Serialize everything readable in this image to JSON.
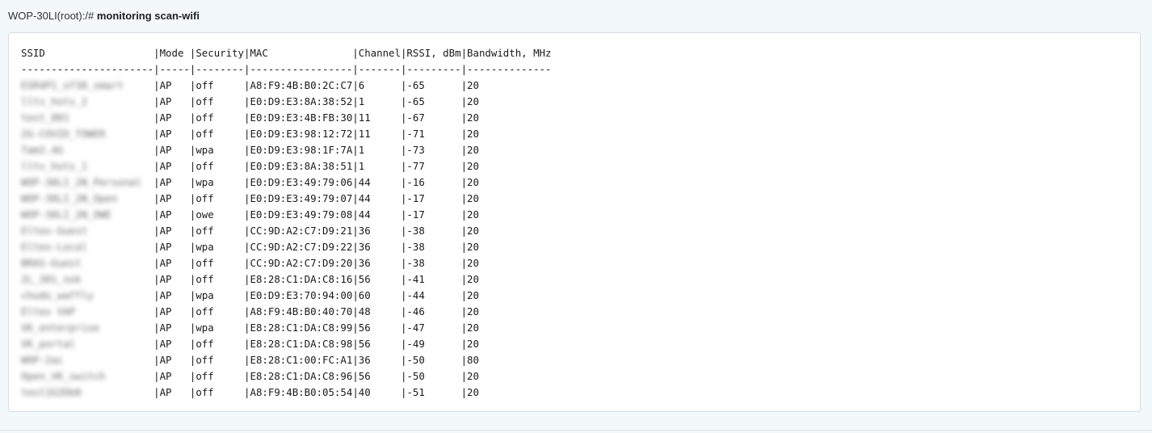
{
  "prompt": {
    "host": "WOP-30LI(root):/# ",
    "command": "monitoring scan-wifi"
  },
  "table": {
    "header": "SSID                  |Mode |Security|MAC              |Channel|RSSI, dBm|Bandwidth, MHz",
    "separator": "----------------------|-----|--------|-----------------|-------|---------|--------------",
    "columns": [
      "SSID",
      "Mode",
      "Security",
      "MAC",
      "Channel",
      "RSSI, dBm",
      "Bandwidth, MHz"
    ],
    "rows": [
      {
        "ssid": "ESR4P1_of30_smart",
        "rest": "|AP   |off     |A8:F9:4B:B0:2C:C7|6      |-65      |20"
      },
      {
        "ssid": "lltv_hots_2",
        "rest": "|AP   |off     |E0:D9:E3:8A:38:52|1      |-65      |20"
      },
      {
        "ssid": "test_801",
        "rest": "|AP   |off     |E0:D9:E3:4B:FB:30|11     |-67      |20"
      },
      {
        "ssid": "2G-COVID_TOWER",
        "rest": "|AP   |off     |E0:D9:E3:98:12:72|11     |-71      |20"
      },
      {
        "ssid": "Tam2.4G",
        "rest": "|AP   |wpa     |E0:D9:E3:98:1F:7A|1      |-73      |20"
      },
      {
        "ssid": "lltv_hots_1",
        "rest": "|AP   |off     |E0:D9:E3:8A:38:51|1      |-77      |20"
      },
      {
        "ssid": "WOP-30LI_2N_Personal",
        "rest": "|AP   |wpa     |E0:D9:E3:49:79:06|44     |-16      |20"
      },
      {
        "ssid": "WOP-30LI_2N_Open",
        "rest": "|AP   |off     |E0:D9:E3:49:79:07|44     |-17      |20"
      },
      {
        "ssid": "WOP-30LI_2N_OWE",
        "rest": "|AP   |owe     |E0:D9:E3:49:79:08|44     |-17      |20"
      },
      {
        "ssid": "Eltex-Guest",
        "rest": "|AP   |off     |CC:9D:A2:C7:D9:21|36     |-38      |20"
      },
      {
        "ssid": "Eltex-Local",
        "rest": "|AP   |wpa     |CC:9D:A2:C7:D9:22|36     |-38      |20"
      },
      {
        "ssid": "BRAS-Guest",
        "rest": "|AP   |off     |CC:9D:A2:C7:D9:20|36     |-38      |20"
      },
      {
        "ssid": "2L_301_nok",
        "rest": "|AP   |off     |E8:28:C1:DA:C8:16|56     |-41      |20"
      },
      {
        "ssid": "chudo_waffly",
        "rest": "|AP   |wpa     |E0:D9:E3:70:94:00|60     |-44      |20"
      },
      {
        "ssid": "Eltex VAP",
        "rest": "|AP   |off     |A8:F9:4B:B0:40:70|48     |-46      |20"
      },
      {
        "ssid": "VK_enterprise",
        "rest": "|AP   |wpa     |E8:28:C1:DA:C8:99|56     |-47      |20"
      },
      {
        "ssid": "VK_portal",
        "rest": "|AP   |off     |E8:28:C1:DA:C8:98|56     |-49      |20"
      },
      {
        "ssid": "WOP-2ac",
        "rest": "|AP   |off     |E8:28:C1:00:FC:A1|36     |-50      |80"
      },
      {
        "ssid": "Open_VK_switch",
        "rest": "|AP   |off     |E8:28:C1:DA:C8:96|56     |-50      |20"
      },
      {
        "ssid": "test1G2Db0",
        "rest": "|AP   |off     |A8:F9:4B:B0:05:54|40     |-51      |20"
      }
    ]
  },
  "colors": {
    "page_background": "#f3f8fb",
    "panel_background": "#ffffff",
    "panel_border": "#d5dde2",
    "text": "#1a1a1a"
  }
}
